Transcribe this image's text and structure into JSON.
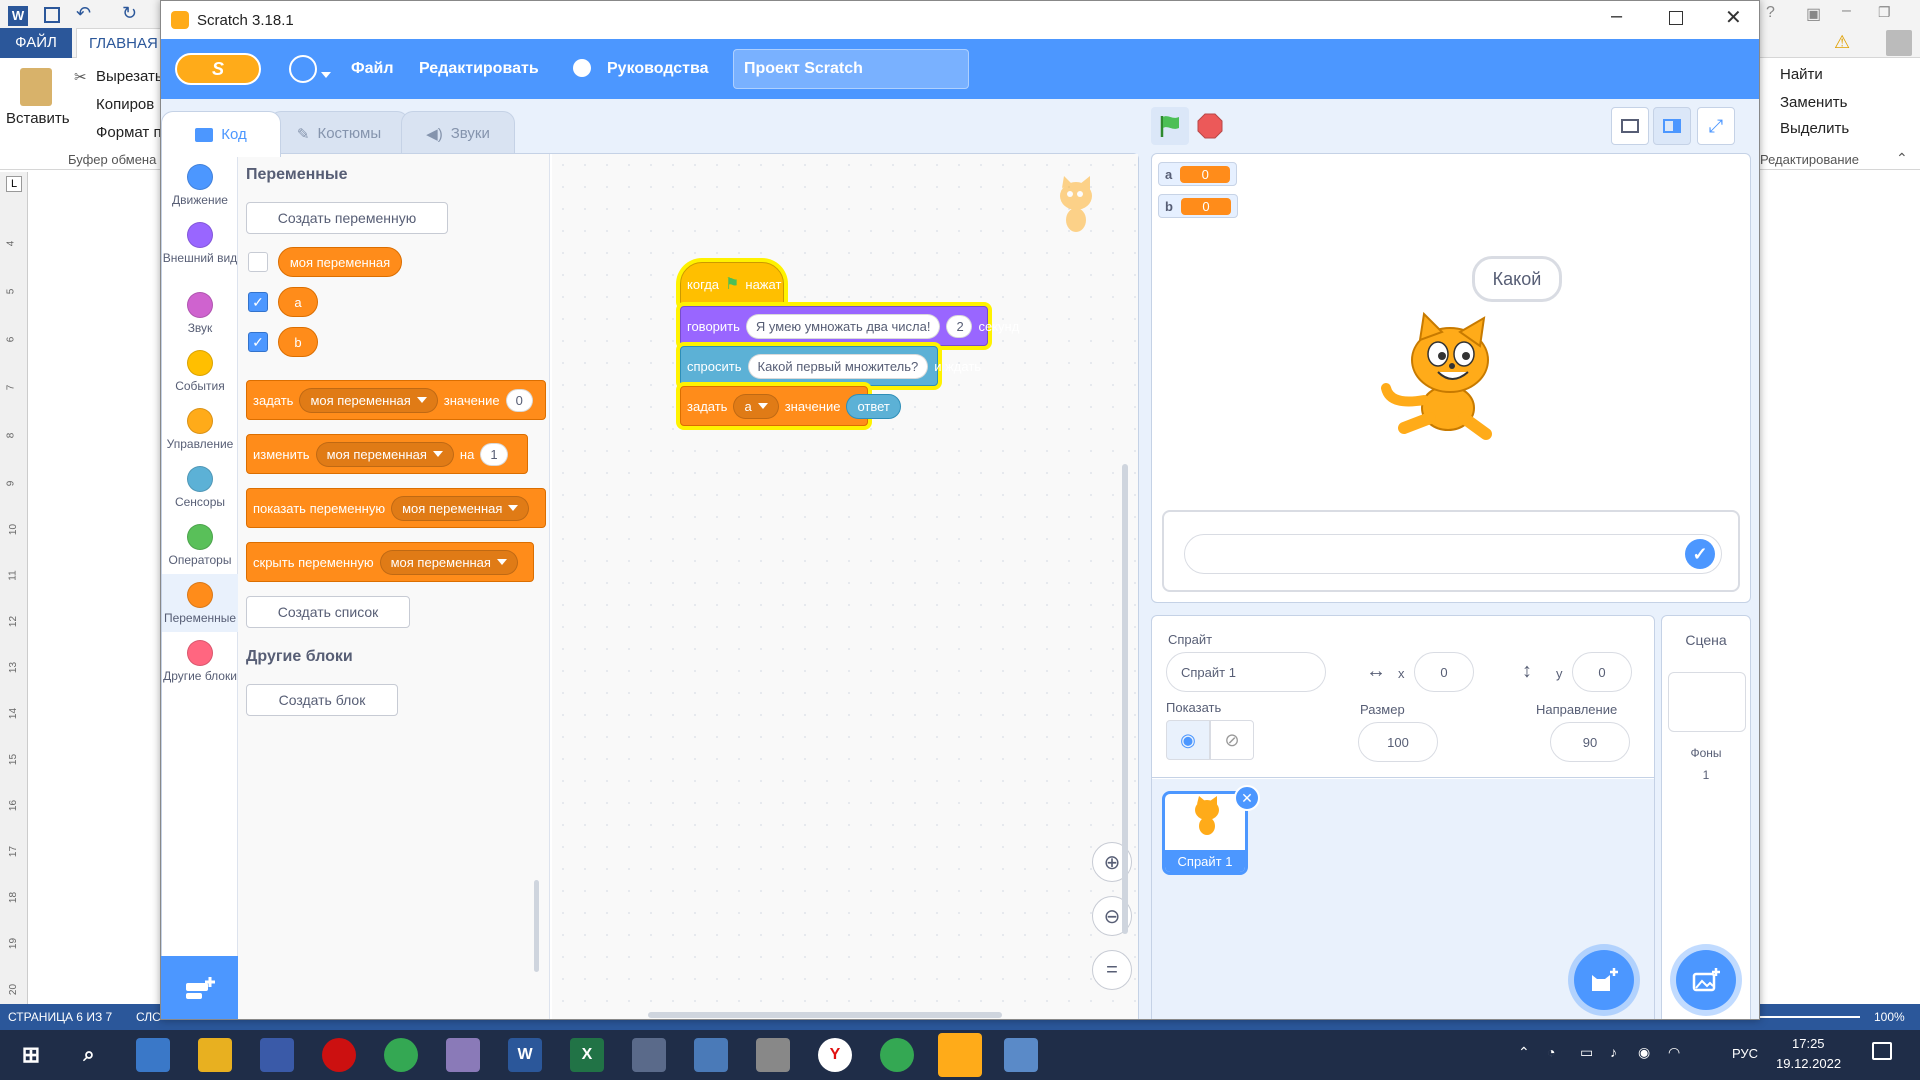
{
  "word": {
    "tabs": {
      "file": "ФАЙЛ",
      "home": "ГЛАВНАЯ"
    },
    "clipboard": {
      "paste": "Вставить",
      "cut": "Вырезать",
      "copy": "Копиров",
      "format": "Формат п",
      "group": "Буфер обмена"
    },
    "editing": {
      "find": "Найти",
      "replace": "Заменить",
      "select": "Выделить",
      "group": "Редактирование"
    },
    "ruler_numbers": [
      "4",
      "5",
      "6",
      "7",
      "8",
      "9",
      "10",
      "11",
      "12",
      "13",
      "14",
      "15",
      "16",
      "17",
      "18",
      "19",
      "20"
    ],
    "ruler_corner": "L",
    "status": {
      "page": "СТРАНИЦА 6 ИЗ 7",
      "words": "СЛС",
      "zoom": "100%"
    }
  },
  "taskbar": {
    "lang": "РУС",
    "time": "17:25",
    "date": "19.12.2022"
  },
  "window": {
    "title": "Scratch 3.18.1"
  },
  "menu": {
    "file": "Файл",
    "edit": "Редактировать",
    "tutorials": "Руководства",
    "project_title": "Проект Scratch"
  },
  "tabs": {
    "code": "Код",
    "costumes": "Костюмы",
    "sounds": "Звуки"
  },
  "categories": [
    {
      "label": "Движение",
      "color": "#4c97ff"
    },
    {
      "label": "Внешний вид",
      "color": "#9966ff"
    },
    {
      "label": "Звук",
      "color": "#cf63cf"
    },
    {
      "label": "События",
      "color": "#ffbf00"
    },
    {
      "label": "Управление",
      "color": "#ffab19"
    },
    {
      "label": "Сенсоры",
      "color": "#5cb1d6"
    },
    {
      "label": "Операторы",
      "color": "#59c059"
    },
    {
      "label": "Переменные",
      "color": "#ff8c1a"
    },
    {
      "label": "Другие блоки",
      "color": "#ff6680"
    }
  ],
  "palette": {
    "heading": "Переменные",
    "make_variable": "Создать переменную",
    "variables": [
      "моя переменная",
      "a",
      "b"
    ],
    "set": {
      "label": "задать",
      "var": "моя переменная",
      "to": "значение",
      "value": "0"
    },
    "change": {
      "label": "изменить",
      "var": "моя переменная",
      "by": "на",
      "value": "1"
    },
    "show": {
      "label": "показать переменную",
      "var": "моя переменная"
    },
    "hide": {
      "label": "скрыть переменную",
      "var": "моя переменная"
    },
    "make_list": "Создать список",
    "more_heading": "Другие блоки",
    "make_block": "Создать блок"
  },
  "script": {
    "hat": {
      "when": "когда",
      "clicked": "нажат"
    },
    "say": {
      "label": "говорить",
      "text": "Я умею умножать два числа!",
      "secs": "2",
      "unit": "секунд"
    },
    "ask": {
      "label": "спросить",
      "text": "Какой первый множитель?",
      "wait": "и ждать"
    },
    "set": {
      "label": "задать",
      "var": "a",
      "to": "значение",
      "value": "ответ"
    }
  },
  "stage": {
    "monitors": [
      {
        "name": "a",
        "value": "0"
      },
      {
        "name": "b",
        "value": "0"
      }
    ],
    "speech": "Какой"
  },
  "sprite": {
    "label": "Спрайт",
    "name": "Спрайт 1",
    "x_label": "x",
    "x": "0",
    "y_label": "y",
    "y": "0",
    "show_label": "Показать",
    "size_label": "Размер",
    "size": "100",
    "direction_label": "Направление",
    "direction": "90",
    "thumb_name": "Спрайт 1"
  },
  "stage_pane": {
    "label": "Сцена",
    "backdrops_label": "Фоны",
    "backdrops": "1"
  }
}
